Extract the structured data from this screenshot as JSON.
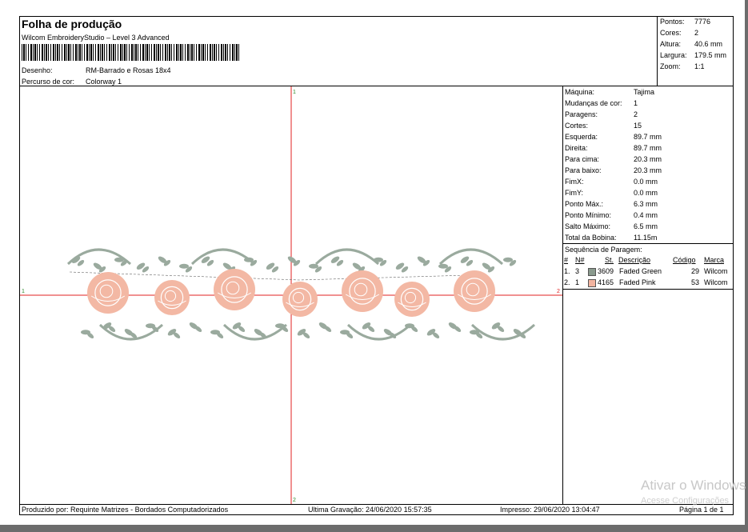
{
  "header": {
    "title": "Folha de produção",
    "software": "Wilcom EmbroideryStudio – Level 3 Advanced",
    "design_label": "Desenho:",
    "design_value": "RM-Barrado e Rosas 18x4",
    "colorway_label": "Percurso de cor:",
    "colorway_value": "Colorway 1"
  },
  "summary": {
    "rows": [
      {
        "label": "Pontos:",
        "value": "7776"
      },
      {
        "label": "Cores:",
        "value": "2"
      },
      {
        "label": "Altura:",
        "value": "40.6 mm"
      },
      {
        "label": "Largura:",
        "value": "179.5 mm"
      },
      {
        "label": "Zoom:",
        "value": "1:1"
      }
    ]
  },
  "stats": {
    "rows": [
      {
        "label": "Máquina:",
        "value": "Tajima"
      },
      {
        "label": "Mudanças de cor:",
        "value": "1"
      },
      {
        "label": "Paragens:",
        "value": "2"
      },
      {
        "label": "Cortes:",
        "value": "15"
      },
      {
        "label": "Esquerda:",
        "value": "89.7 mm"
      },
      {
        "label": "Direita:",
        "value": "89.7 mm"
      },
      {
        "label": "Para cima:",
        "value": "20.3 mm"
      },
      {
        "label": "Para baixo:",
        "value": "20.3 mm"
      },
      {
        "label": "FimX:",
        "value": "0.0 mm"
      },
      {
        "label": "FimY:",
        "value": "0.0 mm"
      },
      {
        "label": "Ponto Máx.:",
        "value": "6.3 mm"
      },
      {
        "label": "Ponto Mínimo:",
        "value": "0.4 mm"
      },
      {
        "label": "Salto Máximo:",
        "value": "6.5 mm"
      },
      {
        "label": "Total da Bobina:",
        "value": "11.15m"
      }
    ]
  },
  "sequence": {
    "title": "Sequência de Paragem:",
    "headers": {
      "num": "#",
      "n": "N#",
      "st": "St.",
      "desc": "Descrição",
      "code": "Código",
      "brand": "Marca"
    },
    "rows": [
      {
        "num": "1.",
        "n": "3",
        "st": "3609",
        "desc": "Faded Green",
        "code": "29",
        "brand": "Wilcom",
        "color": "#8a9a8e"
      },
      {
        "num": "2.",
        "n": "1",
        "st": "4165",
        "desc": "Faded Pink",
        "code": "53",
        "brand": "Wilcom",
        "color": "#f2b4a0"
      }
    ]
  },
  "axis_labels": {
    "top": "1",
    "bottom": "2",
    "left": "1",
    "right": "2"
  },
  "colors": {
    "leaf": "#9aaa9e",
    "rose": "#f3b8a4",
    "axis": "#e02020"
  },
  "footer": {
    "produced_by": "Produzido por: Requinte Matrizes - Bordados Computadorizados",
    "last_saved": "Ultima Gravação: 24/06/2020 15:57:35",
    "printed": "Impresso: 29/06/2020 13:04:47",
    "page": "Página 1 de 1"
  },
  "watermark": {
    "line1": "Ativar o Windows",
    "line2": "Acesse Configurações"
  }
}
